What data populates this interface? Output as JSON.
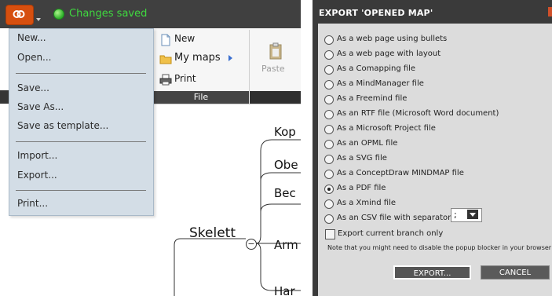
{
  "app": {
    "status_text": "Changes saved",
    "file_menu": {
      "items": [
        "New...",
        "Open...",
        "Save...",
        "Save As...",
        "Save as template...",
        "Import...",
        "Export...",
        "Print..."
      ]
    },
    "ribbon": {
      "new_label": "New",
      "mymaps_label": "My maps",
      "print_label": "Print",
      "paste_label": "Paste",
      "group_label": "File"
    },
    "mindmap": {
      "root": "Skelett",
      "branches": [
        "Kop",
        "Obe",
        "Bec",
        "Arm",
        "Har"
      ]
    }
  },
  "dialog": {
    "title": "EXPORT 'OPENED MAP'",
    "options": [
      "As a web page using bullets",
      "As a web page with layout",
      "As a Comapping file",
      "As a MindManager file",
      "As a Freemind file",
      "As an RTF file (Microsoft Word document)",
      "As a Microsoft Project file",
      "As an OPML file",
      "As a SVG file",
      "As a ConceptDraw MINDMAP file",
      "As a PDF file",
      "As a Xmind file",
      "As an CSV file with separator"
    ],
    "selected_option": "As a PDF file",
    "separator_value": ";",
    "export_branch_label": "Export current branch only",
    "export_branch_checked": false,
    "note": "Note that you might need to disable the popup blocker in your browser",
    "export_button": "EXPORT...",
    "cancel_button": "CANCEL"
  },
  "colors": {
    "topbar": "#404040",
    "status_green": "#3fd93f",
    "logo_orange": "#d64f0f",
    "menu_bg": "#d3dde6",
    "dialog_bg": "#dcdcdc"
  }
}
